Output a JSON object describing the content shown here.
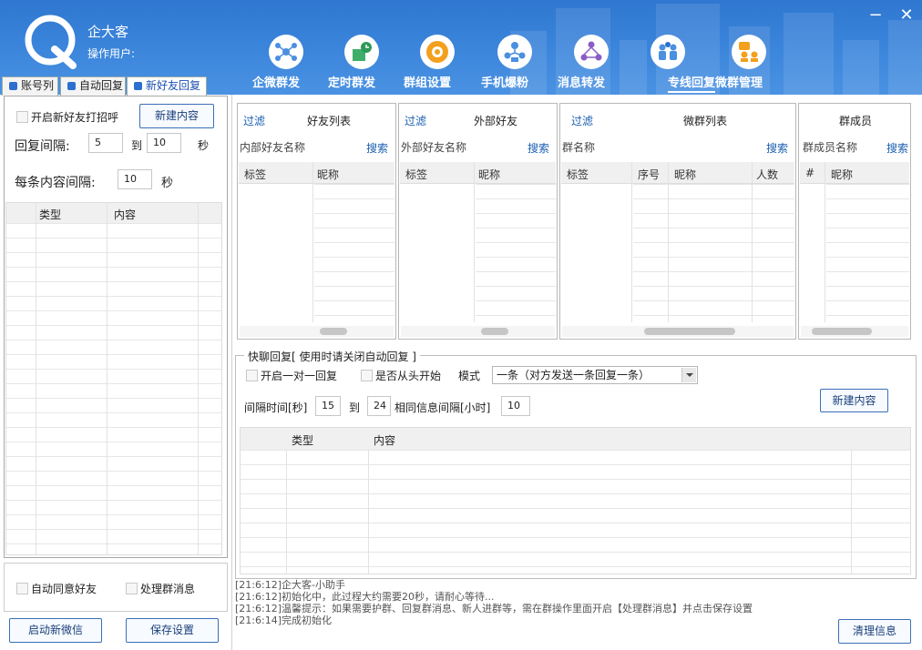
{
  "app": {
    "title": "企大客",
    "user_label": "操作用户:"
  },
  "window_controls": {
    "minimize": "−",
    "close": "✕"
  },
  "nav": [
    {
      "label": "企微群发",
      "icon": "share-icon"
    },
    {
      "label": "定时群发",
      "icon": "schedule-icon"
    },
    {
      "label": "群组设置",
      "icon": "group-settings-icon"
    },
    {
      "label": "手机爆粉",
      "icon": "phone-fans-icon"
    },
    {
      "label": "消息转发",
      "icon": "message-forward-icon"
    },
    {
      "label": "专线回复",
      "icon": "dedicated-reply-icon",
      "active": true
    },
    {
      "label": "微群管理",
      "icon": "group-manage-icon"
    }
  ],
  "left_tabs": [
    {
      "label": "账号列"
    },
    {
      "label": "自动回复"
    },
    {
      "label": "新好友回复",
      "active": true
    }
  ],
  "left": {
    "greet_checkbox": "开启新好友打招呼",
    "new_content_button": "新建内容",
    "reply_interval_label": "回复间隔:",
    "reply_from": "5",
    "to_label": "到",
    "reply_to": "10",
    "seconds": "秒",
    "content_interval_label": "每条内容间隔:",
    "content_interval": "10",
    "table_headers": [
      "类型",
      "内容"
    ],
    "auto_accept": "自动同意好友",
    "handle_group_msg": "处理群消息",
    "start_wechat_button": "启动新微信",
    "save_settings_button": "保存设置"
  },
  "boxes": {
    "friends": {
      "filter": "过滤",
      "title": "好友列表",
      "sub": "内部好友名称",
      "search": "搜索",
      "headers": [
        "标签",
        "昵称"
      ]
    },
    "external": {
      "filter": "过滤",
      "title": "外部好友",
      "sub": "外部好友名称",
      "search": "搜索",
      "headers": [
        "标签",
        "昵称"
      ]
    },
    "groups": {
      "filter": "过滤",
      "title": "微群列表",
      "sub": "群名称",
      "search": "搜索",
      "headers": [
        "标签",
        "序号",
        "昵称",
        "人数"
      ]
    },
    "members": {
      "title": "群成员",
      "sub": "群成员名称",
      "search": "搜索",
      "headers": [
        "#",
        "昵称"
      ]
    }
  },
  "quick_reply": {
    "legend": "快聊回复[ 使用时请关闭自动回复 ]",
    "one_to_one": "开启一对一回复",
    "from_start": "是否从头开始",
    "mode_label": "模式",
    "mode_value": "一条（对方发送一条回复一条）",
    "interval_label": "间隔时间[秒]",
    "interval_from": "15",
    "to_label": "到",
    "interval_to": "24",
    "same_info_label": "相同信息间隔[小时]",
    "same_info_value": "10",
    "new_content_button": "新建内容",
    "table_headers": [
      "类型",
      "内容"
    ]
  },
  "log": {
    "lines": [
      "[21:6:12]企大客-小助手",
      "[21:6:12]初始化中，此过程大约需要20秒，请耐心等待...",
      "[21:6:12]温馨提示：如果需要护群、回复群消息、新人进群等，需在群操作里面开启【处理群消息】并点击保存设置",
      "[21:6:14]完成初始化"
    ],
    "clear_button": "清理信息"
  }
}
